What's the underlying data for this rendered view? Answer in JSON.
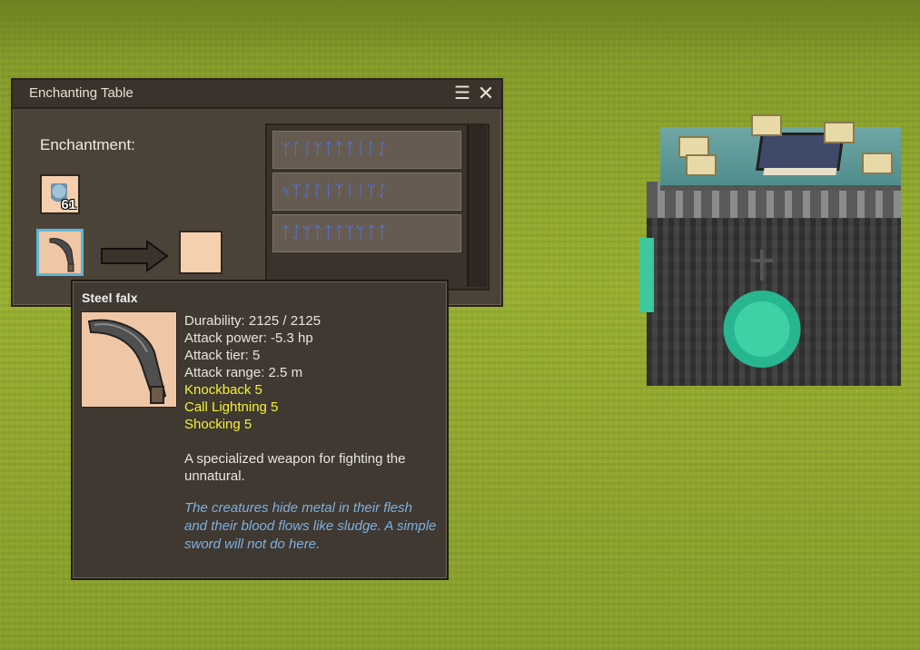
{
  "dialog": {
    "title": "Enchanting Table",
    "enchantment_label": "Enchantment:",
    "lapis_count": "61",
    "runes": [
      "ᛘᛚᛁᛘᛏᛏᛏᛁᛚᛇ",
      "ᛃᛘᛇᛚᛁᛉᛁᛁᛘᛇ",
      "ᛏᛇᛘᛏᛏᛏᛉᛘᛏᛏ"
    ]
  },
  "tooltip": {
    "name": "Steel falx",
    "stats": [
      "Durability: 2125 / 2125",
      "Attack power: -5.3 hp",
      "Attack tier: 5",
      "Attack range: 2.5 m"
    ],
    "enchantments": [
      "Knockback 5",
      "Call Lightning 5",
      "Shocking 5"
    ],
    "description": "A specialized weapon for fighting the unnatural.",
    "lore": "The creatures hide metal in their flesh and their blood flows like sludge. A simple sword will not do here."
  },
  "colors": {
    "enchant_text": "#f4f032",
    "lore_text": "#7fb0e0",
    "rune_text": "#4a7bff",
    "selected_slot_border": "#5fb6d6"
  },
  "icons": {
    "menu": "hamburger-menu-icon",
    "close": "close-icon",
    "arrow": "right-arrow-icon",
    "lapis": "lapis-lazuli-icon",
    "weapon": "steel-falx-icon"
  }
}
